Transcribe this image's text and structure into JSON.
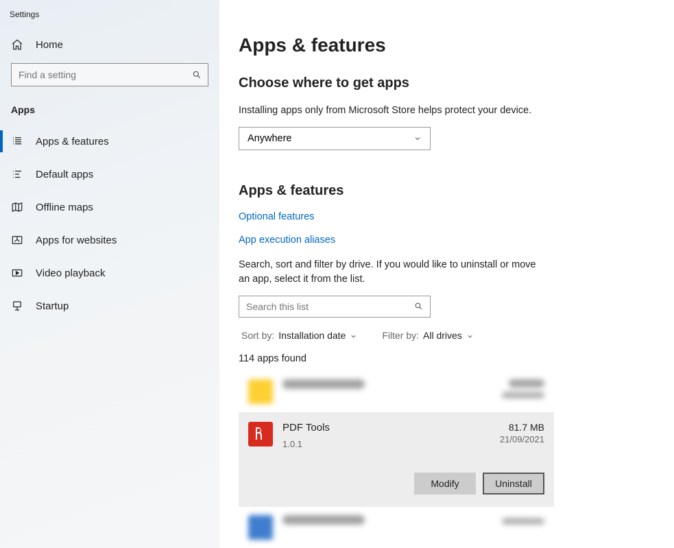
{
  "window_title": "Settings",
  "sidebar": {
    "home": "Home",
    "search_placeholder": "Find a setting",
    "section_label": "Apps",
    "items": [
      {
        "label": "Apps & features",
        "active": true
      },
      {
        "label": "Default apps"
      },
      {
        "label": "Offline maps"
      },
      {
        "label": "Apps for websites"
      },
      {
        "label": "Video playback"
      },
      {
        "label": "Startup"
      }
    ]
  },
  "main": {
    "title": "Apps & features",
    "choose_title": "Choose where to get apps",
    "choose_desc": "Installing apps only from Microsoft Store helps protect your device.",
    "choose_value": "Anywhere",
    "af_title": "Apps & features",
    "link_optional": "Optional features",
    "link_aliases": "App execution aliases",
    "af_desc": "Search, sort and filter by drive. If you would like to uninstall or move an app, select it from the list.",
    "list_search_placeholder": "Search this list",
    "sort_label": "Sort by:",
    "sort_value": "Installation date",
    "filter_label": "Filter by:",
    "filter_value": "All drives",
    "count": "114 apps found",
    "selected": {
      "name": "PDF Tools",
      "version": "1.0.1",
      "size": "81.7 MB",
      "date": "21/09/2021",
      "modify": "Modify",
      "uninstall": "Uninstall"
    }
  }
}
